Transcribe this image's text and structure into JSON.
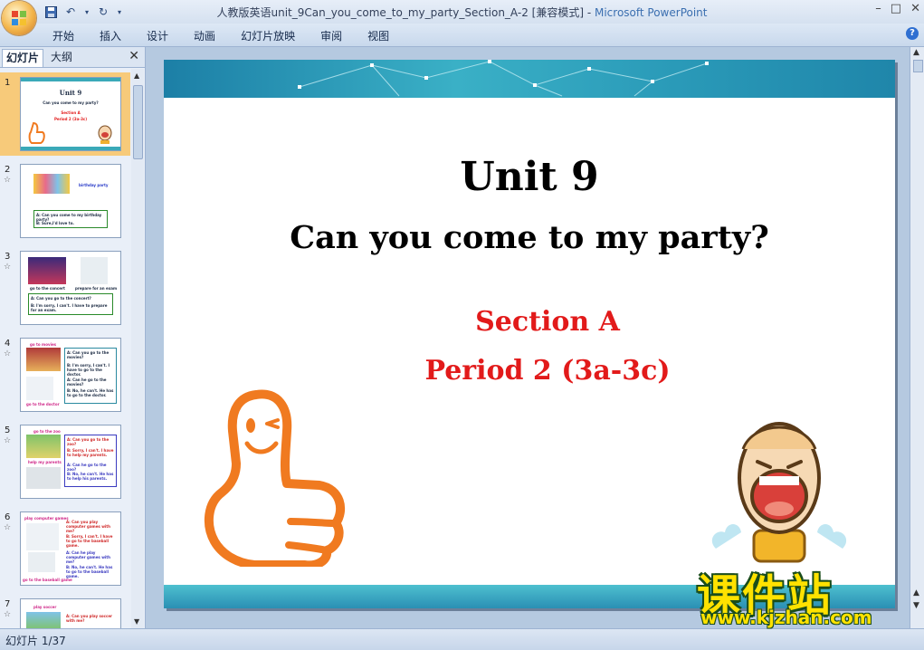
{
  "window": {
    "title_doc": "人教版英语unit_9Can_you_come_to_my_party_Section_A-2 [兼容模式] - ",
    "title_app": "Microsoft PowerPoint",
    "controls": [
      "–",
      "□",
      "✕"
    ]
  },
  "ribbon": {
    "tabs": [
      "开始",
      "插入",
      "设计",
      "动画",
      "幻灯片放映",
      "审阅",
      "视图"
    ],
    "help": "?"
  },
  "panel": {
    "tab_slides": "幻灯片",
    "tab_outline": "大纲",
    "close": "✕",
    "thumbnails": [
      {
        "num": "1",
        "lines": [
          "Unit 9",
          "Can you come to my party?",
          "Section A",
          "Period 2 (3a-3c)"
        ]
      },
      {
        "num": "2",
        "lines": [
          "birthday party",
          "A: Can you come to my birthday party?",
          "B: Sure,I'd love to."
        ]
      },
      {
        "num": "3",
        "lines": [
          "go to the concert",
          "prepare for an exam",
          "A: Can you go to the concert?",
          "B: I'm sorry, I can't. I have to prepare for an exam."
        ]
      },
      {
        "num": "4",
        "lines": [
          "go to movies",
          "A: Can you go to the movies?",
          "B: I'm sorry, I can't. I have to go to the doctor.",
          "A: Can he go to the movies?",
          "B: No, he can't. He has to go to the doctor.",
          "go to the doctor"
        ]
      },
      {
        "num": "5",
        "lines": [
          "go to the zoo",
          "A: Can you go to the zoo?",
          "B: Sorry, I can't. I have to help my parents.",
          "A: Can he go to the zoo?",
          "B: No, he can't. He has to help his parents.",
          "help my parents"
        ]
      },
      {
        "num": "6",
        "lines": [
          "play computer games",
          "A: Can you play computer games with me?",
          "B: Sorry, I can't. I have to go to the baseball game.",
          "A: Can he play computer games with me?",
          "B: No, he can't. He has to go to the baseball game.",
          "go to the baseball game"
        ]
      },
      {
        "num": "7",
        "lines": [
          "play soccer",
          "A: Can you play soccer with me?"
        ]
      }
    ]
  },
  "slide": {
    "title": "Unit 9",
    "subtitle": "Can you come to my party?",
    "section": "Section A",
    "period": "Period 2 (3a-3c)"
  },
  "watermark": {
    "cn": "课件站",
    "url": "www.kjzhan.com"
  },
  "status": {
    "text": "幻灯片 1/37"
  }
}
